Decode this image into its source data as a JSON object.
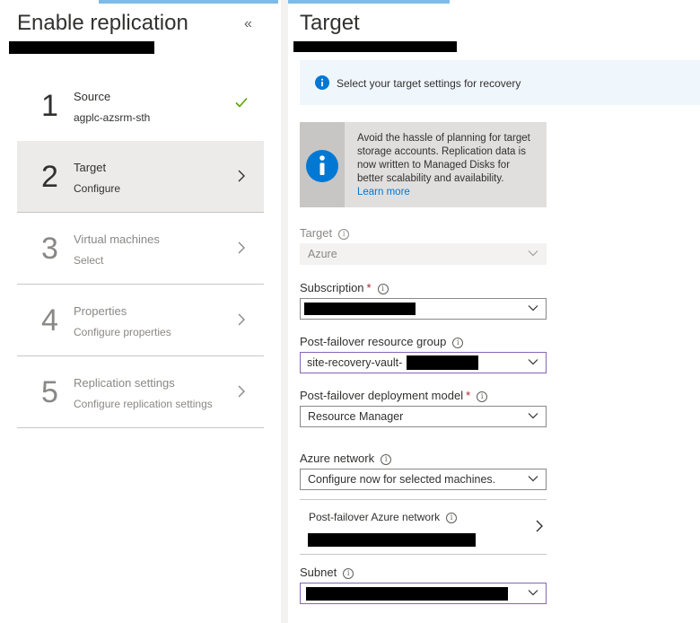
{
  "left": {
    "title": "Enable replication",
    "collapse_icon": "«",
    "steps": [
      {
        "number": "1",
        "label": "Source",
        "sub": "agplc-azsrm-sth",
        "state": "done"
      },
      {
        "number": "2",
        "label": "Target",
        "sub": "Configure",
        "state": "active"
      },
      {
        "number": "3",
        "label": "Virtual machines",
        "sub": "Select",
        "state": "disabled"
      },
      {
        "number": "4",
        "label": "Properties",
        "sub": "Configure properties",
        "state": "disabled"
      },
      {
        "number": "5",
        "label": "Replication settings",
        "sub": "Configure replication settings",
        "state": "disabled"
      }
    ]
  },
  "right": {
    "title": "Target",
    "info_bar": "Select your target settings for recovery",
    "banner": {
      "text": "Avoid the hassle of planning for target storage accounts. Replication data is now written to Managed Disks for better scalability and availability.",
      "link": "Learn more"
    },
    "fields": {
      "target": {
        "label": "Target",
        "value": "Azure"
      },
      "subscription": {
        "label": "Subscription",
        "value": ""
      },
      "resource_group": {
        "label": "Post-failover resource group",
        "value": "site-recovery-vault-"
      },
      "deployment_model": {
        "label": "Post-failover deployment model",
        "value": "Resource Manager"
      },
      "azure_network": {
        "label": "Azure network",
        "value": "Configure now for selected machines."
      },
      "failover_network": {
        "label": "Post-failover Azure network"
      },
      "subnet": {
        "label": "Subnet",
        "value": ""
      }
    },
    "required_mark": "*",
    "info_glyph": "i"
  },
  "colors": {
    "accent": "#0078d4",
    "success": "#57a300",
    "required": "#a4262c",
    "focus_border": "#8764b8"
  }
}
